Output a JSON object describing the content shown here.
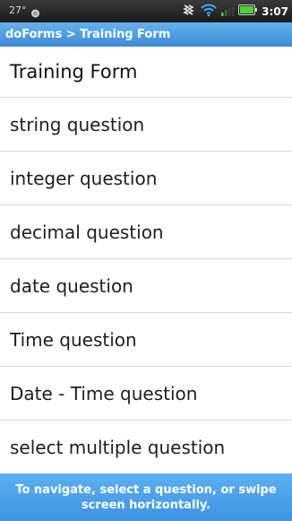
{
  "status_bar": {
    "temperature": "27°",
    "time": "3:07",
    "icons": [
      "weather-icon",
      "vibrate-icon",
      "wifi-icon",
      "signal-icon",
      "battery-icon"
    ]
  },
  "title_bar": {
    "breadcrumb": "doForms > Training Form"
  },
  "form": {
    "title": "Training Form",
    "questions": [
      "string question",
      "integer question",
      "decimal question",
      "date question",
      "Time question",
      "Date - Time question",
      "select multiple question"
    ]
  },
  "hint": {
    "text": "To navigate, select a question, or swipe screen horizontally."
  },
  "colors": {
    "title_bar": "#4a9de3",
    "hint_bar": "#4ea3ea",
    "battery": "#4cd137"
  }
}
